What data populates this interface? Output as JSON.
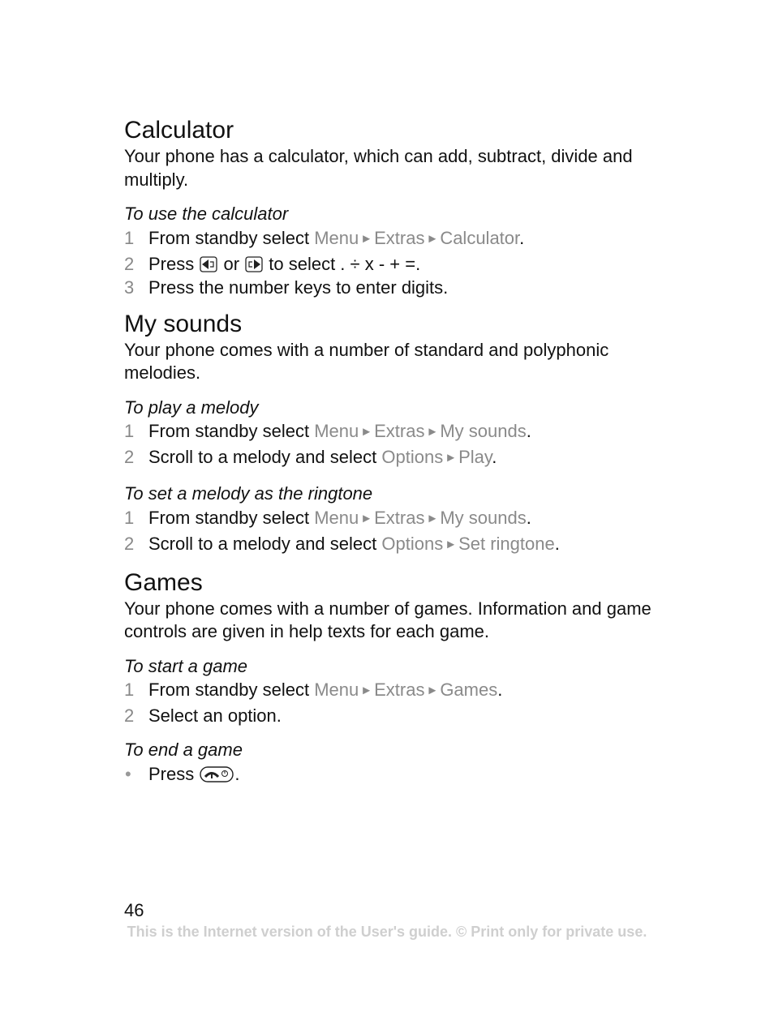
{
  "sections": {
    "calculator": {
      "title": "Calculator",
      "intro": "Your phone has a calculator, which can add, subtract, divide and multiply.",
      "task_title": "To use the calculator",
      "steps": [
        {
          "num": "1",
          "pre": "From standby select ",
          "menu": [
            "Menu",
            "Extras",
            "Calculator"
          ],
          "post": "."
        },
        {
          "num": "2",
          "pre": "Press ",
          "mid": " or ",
          "post": " to select . ÷ x - + =.",
          "key_left": "navigation-left-key-icon",
          "key_right": "navigation-right-key-icon"
        },
        {
          "num": "3",
          "text": "Press the number keys to enter digits."
        }
      ]
    },
    "my_sounds": {
      "title": "My sounds",
      "intro": "Your phone comes with a number of standard and polyphonic melodies.",
      "tasks": [
        {
          "title": "To play a melody",
          "steps": [
            {
              "num": "1",
              "pre": "From standby select ",
              "menu": [
                "Menu",
                "Extras",
                "My sounds"
              ],
              "post": "."
            },
            {
              "num": "2",
              "pre": "Scroll to a melody and select ",
              "menu": [
                "Options",
                "Play"
              ],
              "post": "."
            }
          ]
        },
        {
          "title": "To set a melody as the ringtone",
          "steps": [
            {
              "num": "1",
              "pre": "From standby select ",
              "menu": [
                "Menu",
                "Extras",
                "My sounds"
              ],
              "post": "."
            },
            {
              "num": "2",
              "pre": "Scroll to a melody and select ",
              "menu": [
                "Options",
                "Set ringtone"
              ],
              "post": "."
            }
          ]
        }
      ]
    },
    "games": {
      "title": "Games",
      "intro": "Your phone comes with a number of games. Information and game controls are given in help texts for each game.",
      "tasks": [
        {
          "title": "To start a game",
          "steps": [
            {
              "num": "1",
              "pre": "From standby select ",
              "menu": [
                "Menu",
                "Extras",
                "Games"
              ],
              "post": "."
            },
            {
              "num": "2",
              "text": "Select an option."
            }
          ]
        },
        {
          "title": "To end a game",
          "bullet": {
            "pre": "Press ",
            "post": ".",
            "key": "end-call-key-icon"
          }
        }
      ]
    }
  },
  "arrow_glyph": "►",
  "bullet_glyph": "•",
  "page_number": "46",
  "footer": "This is the Internet version of the User's guide. © Print only for private use."
}
